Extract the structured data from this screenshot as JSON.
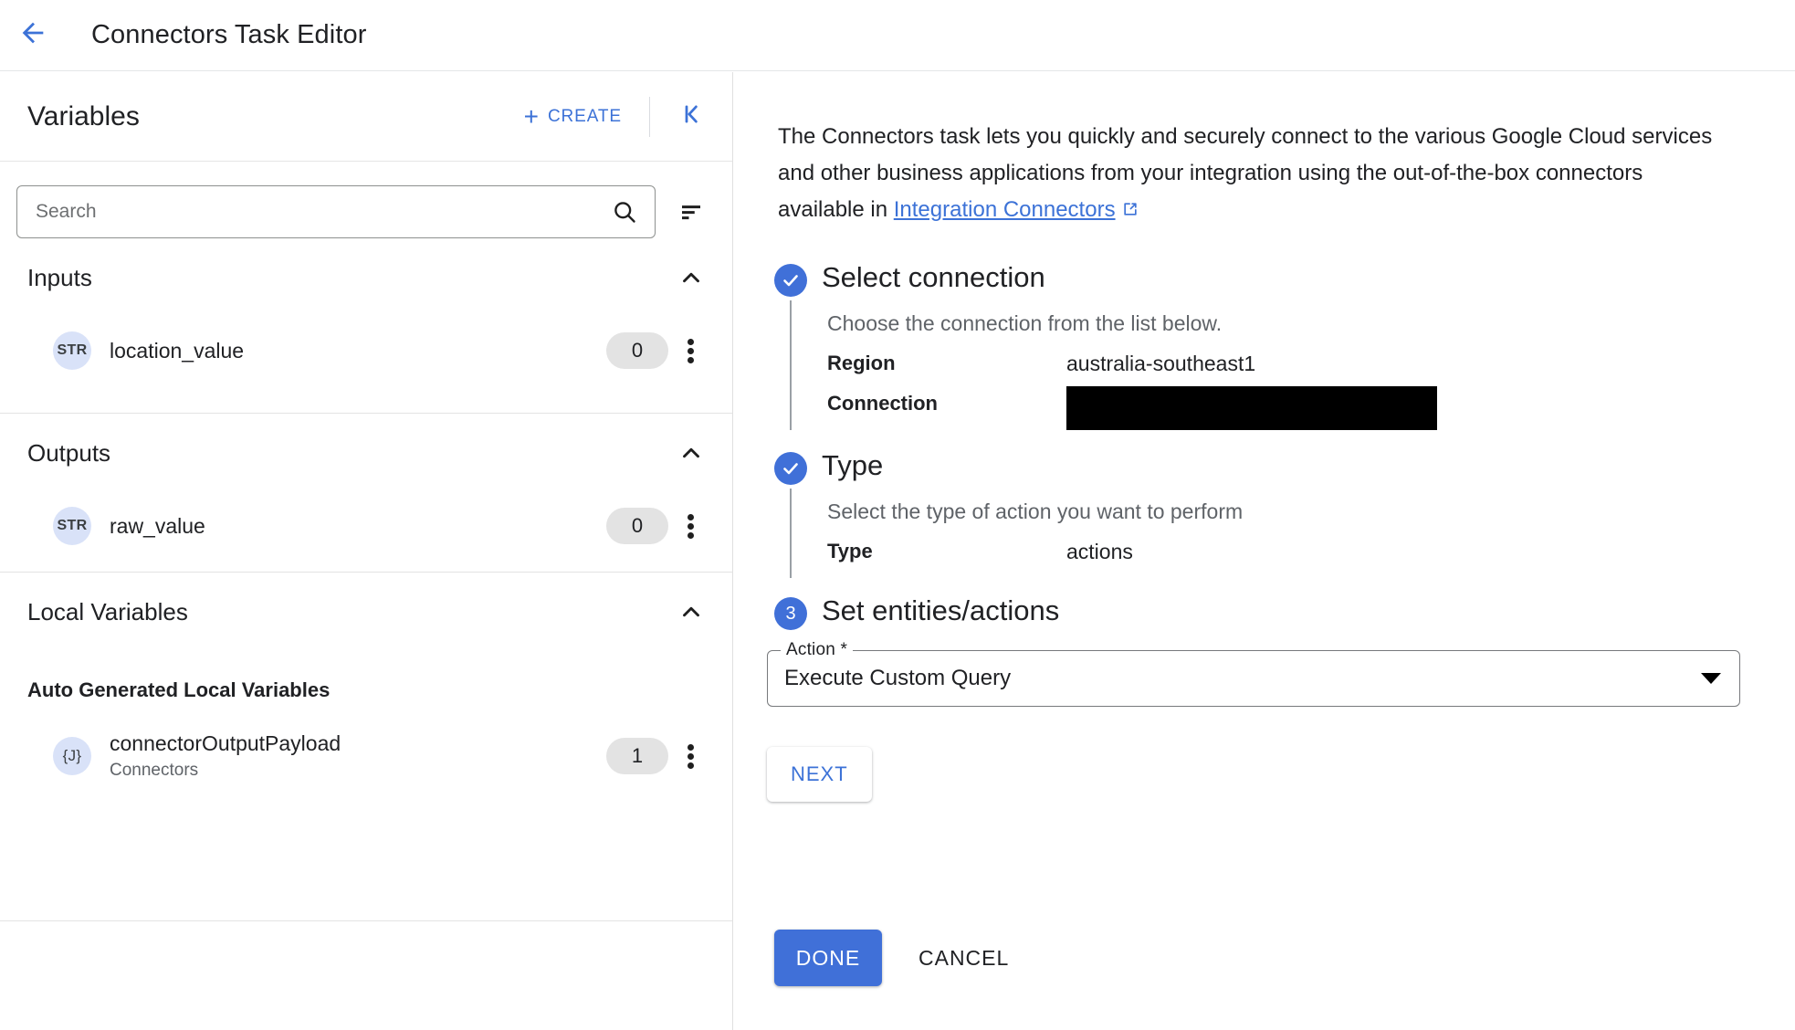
{
  "appbar": {
    "back_icon": "arrow-back-icon",
    "title": "Connectors Task Editor"
  },
  "sidebar": {
    "title": "Variables",
    "create_label": "CREATE",
    "create_icon": "plus-icon",
    "collapse_icon": "collapse-panel-left-icon",
    "search": {
      "placeholder": "Search",
      "value": "",
      "search_icon": "search-icon"
    },
    "sort_icon": "sort-filter-list-icon",
    "sections": [
      {
        "name": "Inputs",
        "chevron": "chevron-up-icon",
        "variables": [
          {
            "type": "STR",
            "name": "location_value",
            "subtitle": "",
            "count": "0",
            "menu_icon": "more-vert-icon"
          }
        ]
      },
      {
        "name": "Outputs",
        "chevron": "chevron-up-icon",
        "variables": [
          {
            "type": "STR",
            "name": "raw_value",
            "subtitle": "",
            "count": "0",
            "menu_icon": "more-vert-icon"
          }
        ]
      },
      {
        "name": "Local Variables",
        "chevron": "chevron-up-icon",
        "subsection_title": "Auto Generated Local Variables",
        "variables": [
          {
            "type": "{J}",
            "name": "connectorOutputPayload",
            "subtitle": "Connectors",
            "count": "1",
            "menu_icon": "more-vert-icon"
          }
        ]
      }
    ]
  },
  "main": {
    "description": {
      "text_before": "The Connectors task lets you quickly and securely connect to the various Google Cloud services and other business applications from your integration using the out-of-the-box connectors available in ",
      "link_label": "Integration Connectors",
      "link_icon": "open-in-new-icon"
    },
    "steps": [
      {
        "marker": "check-icon",
        "state": "complete",
        "title": "Select connection",
        "subtitle": "Choose the connection from the list below.",
        "fields": [
          {
            "key": "Region",
            "value": "australia-southeast1",
            "redacted": false
          },
          {
            "key": "Connection",
            "value": "",
            "redacted": true
          }
        ]
      },
      {
        "marker": "check-icon",
        "state": "complete",
        "title": "Type",
        "subtitle": "Select the type of action you want to perform",
        "fields": [
          {
            "key": "Type",
            "value": "actions",
            "redacted": false
          }
        ]
      },
      {
        "marker": "3",
        "state": "active",
        "title": "Set entities/actions",
        "subtitle": "",
        "fields": []
      }
    ],
    "action_select": {
      "label": "Action *",
      "value": "Execute Custom Query",
      "caret_icon": "dropdown-caret-icon"
    },
    "next_label": "NEXT"
  },
  "footer": {
    "done_label": "DONE",
    "cancel_label": "CANCEL"
  },
  "colors": {
    "accent_blue": "#4070d8",
    "link_blue": "#3c72d7",
    "type_badge_bg": "#d9e2f8",
    "pill_bg": "#e3e3e3",
    "rail_grey": "#9aa0a6"
  }
}
